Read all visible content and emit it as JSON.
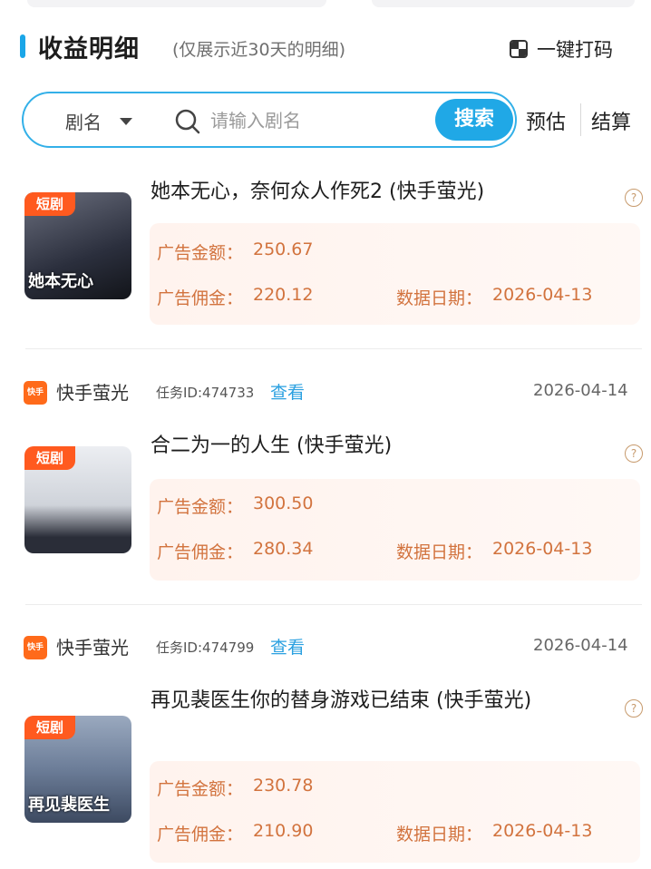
{
  "header": {
    "title": "收益明细",
    "subtitle": "(仅展示近30天的明细)",
    "mosaic_label": "一键打码"
  },
  "search": {
    "dropdown_label": "剧名",
    "placeholder": "请输入剧名",
    "button_label": "搜索"
  },
  "tabs": {
    "estimate": "预估",
    "settle": "结算"
  },
  "records": [
    {
      "title": "她本无心，奈何众人作死2 (快手萤光)",
      "cover_tag": "短剧",
      "cover_caption": "她本无心",
      "ad_amount_label": "广告金额：",
      "ad_amount": "250.67",
      "ad_commission_label": "广告佣金：",
      "ad_commission": "220.12",
      "data_date_label": "数据日期：",
      "data_date": "2026-04-13"
    },
    {
      "platform": "快手萤光",
      "task_id": "任务ID:474733",
      "view_label": "查看",
      "date": "2026-04-14",
      "title": "合二为一的人生 (快手萤光)",
      "cover_tag": "短剧",
      "cover_caption": "",
      "ad_amount_label": "广告金额：",
      "ad_amount": "300.50",
      "ad_commission_label": "广告佣金：",
      "ad_commission": "280.34",
      "data_date_label": "数据日期：",
      "data_date": "2026-04-13"
    },
    {
      "platform": "快手萤光",
      "task_id": "任务ID:474799",
      "view_label": "查看",
      "date": "2026-04-14",
      "title": "再见裴医生你的替身游戏已结束 (快手萤光)",
      "cover_tag": "短剧",
      "cover_caption": "再见裴医生",
      "ad_amount_label": "广告金额：",
      "ad_amount": "230.78",
      "ad_commission_label": "广告佣金：",
      "ad_commission": "210.90",
      "data_date_label": "数据日期：",
      "data_date": "2026-04-13"
    }
  ],
  "colors": {
    "accent": "#20a8e6",
    "stat_text": "#d2733e",
    "tag": "#ff5a1f"
  },
  "icons": {
    "search": "search-icon",
    "help": "question-circle-icon",
    "mosaic": "mosaic-icon",
    "kuaishou": "kuaishou-logo-icon"
  }
}
